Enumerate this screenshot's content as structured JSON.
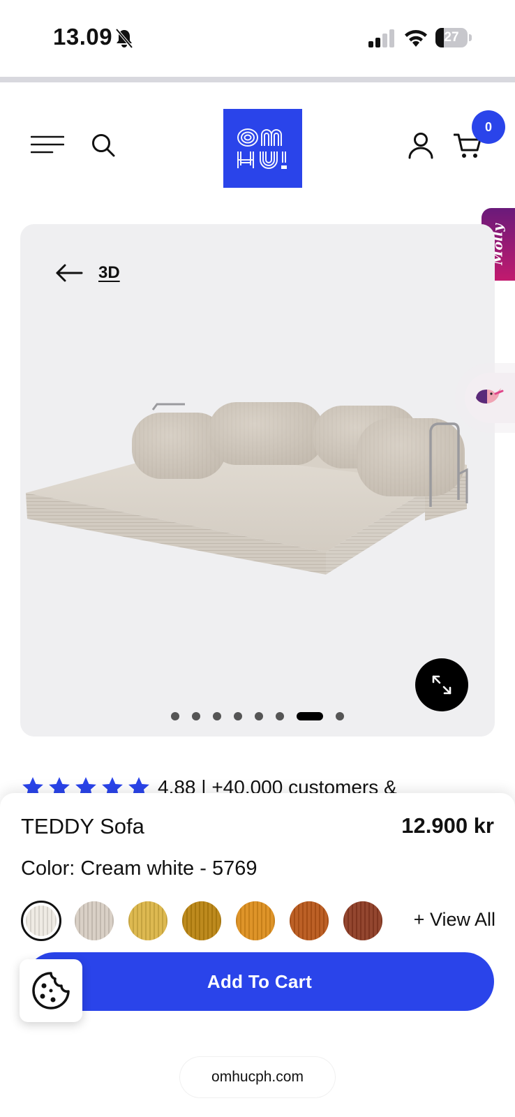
{
  "status_bar": {
    "time": "13.09",
    "battery_level": "27",
    "battery_fraction": 0.27,
    "icons": [
      "bell-slash-icon",
      "signal-icon",
      "wifi-icon",
      "battery-icon"
    ]
  },
  "header": {
    "menu_icon": "hamburger-menu-icon",
    "search_icon": "search-icon",
    "logo_text": "OM HU!",
    "account_icon": "account-icon",
    "cart_icon": "cart-icon",
    "cart_count": "0"
  },
  "side_tab": {
    "label": "Molly"
  },
  "gallery": {
    "back_label": "3D",
    "image": "teddy-sofa-cream-white",
    "slide_count": 8,
    "active_slide": 7,
    "expand_icon": "expand-icon"
  },
  "reviews": {
    "stars": 5,
    "text": "4.88 | +40.000 customers &"
  },
  "product": {
    "title": "TEDDY Sofa",
    "price": "12.900 kr",
    "color_label": "Color: Cream white - 5769",
    "swatches": [
      {
        "name": "Cream white",
        "color": "#eeeae2",
        "selected": true
      },
      {
        "name": "Beige",
        "color": "#d7cdc2",
        "selected": false
      },
      {
        "name": "Yellow",
        "color": "#dbb546",
        "selected": false
      },
      {
        "name": "Ochre",
        "color": "#b98310",
        "selected": false
      },
      {
        "name": "Amber",
        "color": "#dc8d1c",
        "selected": false
      },
      {
        "name": "Rust",
        "color": "#b85618",
        "selected": false
      },
      {
        "name": "Brown",
        "color": "#8c3a22",
        "selected": false
      }
    ],
    "view_all": "+ View All",
    "add_to_cart": "Add To Cart"
  },
  "cookie_icon": "cookie-icon",
  "url": "omhucph.com",
  "colors": {
    "brand_blue": "#2a44ea",
    "molly_purple": "#6a1a7a",
    "molly_pink": "#c21a6e",
    "gallery_bg": "#efeff1"
  }
}
